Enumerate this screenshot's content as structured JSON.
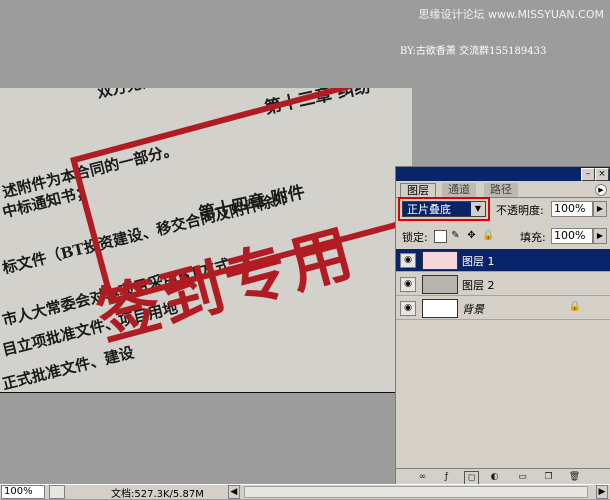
{
  "watermark": "思缘设计论坛 www.MISSYUAN.COM",
  "credit": "BY:古欲香萧  交流群155189433",
  "document": {
    "lines": [
      "双方无法达成同内容产生纠纷，双方应本着",
      "第十三章  纠纷",
      "述附件为本合同的一部分。",
      "中标通知书；",
      "标文件（BT投资建设、移交合同及附件除外",
      "市人大常委会对本项目采用BT方式",
      "目立项批准文件、项目用地",
      "正式批准文件、建设",
      "第十四章  附件"
    ],
    "stamp": "签到专用"
  },
  "layers_panel": {
    "tabs": [
      "图层",
      "通道",
      "路径"
    ],
    "blend_mode": "正片叠底",
    "opacity_label": "不透明度:",
    "opacity_value": "100%",
    "lock_label": "锁定:",
    "fill_label": "填充:",
    "fill_value": "100%",
    "layers": [
      {
        "name": "图层 1",
        "selected": true
      },
      {
        "name": "图层 2",
        "selected": false
      },
      {
        "name": "背景",
        "selected": false,
        "locked": true
      }
    ]
  },
  "statusbar": {
    "zoom": "100%",
    "doc_info": "文档:527.3K/5.87M"
  },
  "colors": {
    "stamp_red": "#b11c22",
    "selection_blue": "#0a246a",
    "highlight_red": "#e00000"
  }
}
